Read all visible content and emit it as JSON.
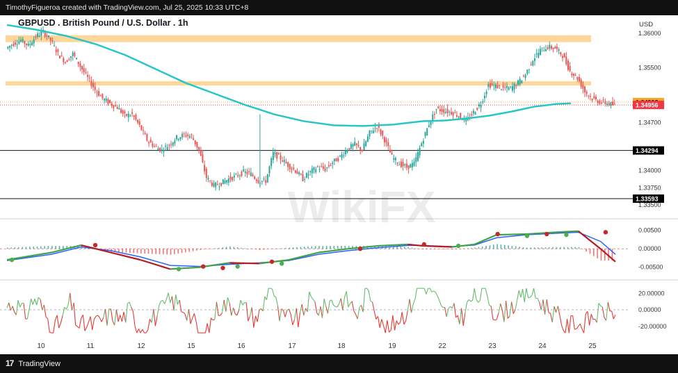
{
  "header": {
    "credit": "TimothyFigueroa created with TradingView.com, Jul 25, 2025 10:33 UTC+8"
  },
  "footer": {
    "brand": "TradingView",
    "logo_text": "17"
  },
  "watermark": {
    "text": "WikiFX"
  },
  "chart_data": {
    "type": "candlestick",
    "title": "GBPUSD . British Pound / U.S. Dollar . 1h",
    "currency": "USD",
    "price_axis": {
      "range": [
        1.3335,
        1.3618
      ],
      "ticks": [
        {
          "label": "1.36000",
          "value": 1.36
        },
        {
          "label": "1.35500",
          "value": 1.355
        },
        {
          "label": "1.34700",
          "value": 1.347
        },
        {
          "label": "1.34000",
          "value": 1.34
        },
        {
          "label": "1.33750",
          "value": 1.3375
        },
        {
          "label": "1.33500",
          "value": 1.335
        }
      ]
    },
    "price_tags": [
      {
        "label": "1.34998",
        "value": 1.34998,
        "color": "#f5a623",
        "text_color": "#000000"
      },
      {
        "label": "1.34956",
        "value": 1.34956,
        "color": "#f23645",
        "text_color": "#ffffff"
      },
      {
        "label": "1.34294",
        "value": 1.34294,
        "color": "#000000",
        "text_color": "#ffffff"
      },
      {
        "label": "1.33593",
        "value": 1.33593,
        "color": "#000000",
        "text_color": "#ffffff"
      }
    ],
    "horizontal_lines": [
      1.34294,
      1.33593
    ],
    "zones": [
      {
        "low": 1.3587,
        "high": 1.3597,
        "color": "#ffd699"
      },
      {
        "low": 1.3524,
        "high": 1.353,
        "color": "#ffd699"
      }
    ],
    "x_labels": [
      "10",
      "11",
      "12",
      "15",
      "16",
      "17",
      "18",
      "19",
      "22",
      "23",
      "24",
      "25"
    ],
    "moving_average": {
      "color": "#26c6c6",
      "points": [
        [
          0,
          1.3612
        ],
        [
          4,
          1.3605
        ],
        [
          8,
          1.3596
        ],
        [
          12,
          1.3584
        ],
        [
          16,
          1.3568
        ],
        [
          20,
          1.3548
        ],
        [
          24,
          1.3528
        ],
        [
          28,
          1.3512
        ],
        [
          32,
          1.3496
        ],
        [
          36,
          1.3482
        ],
        [
          40,
          1.3472
        ],
        [
          44,
          1.3466
        ],
        [
          48,
          1.3465
        ],
        [
          52,
          1.3467
        ],
        [
          56,
          1.3472
        ],
        [
          59,
          1.3473
        ],
        [
          62,
          1.3476
        ],
        [
          65,
          1.348
        ],
        [
          68,
          1.3486
        ],
        [
          71,
          1.3493
        ],
        [
          74,
          1.3497
        ],
        [
          76,
          1.3498
        ]
      ]
    },
    "price_path": [
      [
        0,
        1.3578
      ],
      [
        1,
        1.3585
      ],
      [
        2,
        1.359
      ],
      [
        3,
        1.3582
      ],
      [
        4,
        1.3595
      ],
      [
        5,
        1.3602
      ],
      [
        6,
        1.359
      ],
      [
        7,
        1.357
      ],
      [
        8,
        1.3558
      ],
      [
        9,
        1.357
      ],
      [
        10,
        1.3552
      ],
      [
        11,
        1.3535
      ],
      [
        12,
        1.3518
      ],
      [
        13,
        1.3505
      ],
      [
        14,
        1.3498
      ],
      [
        15,
        1.3492
      ],
      [
        16,
        1.348
      ],
      [
        17,
        1.3482
      ],
      [
        18,
        1.3465
      ],
      [
        19,
        1.3445
      ],
      [
        20,
        1.3435
      ],
      [
        21,
        1.343
      ],
      [
        22,
        1.3438
      ],
      [
        23,
        1.3448
      ],
      [
        24,
        1.3452
      ],
      [
        25,
        1.345
      ],
      [
        26,
        1.343
      ],
      [
        27,
        1.339
      ],
      [
        28,
        1.3378
      ],
      [
        29,
        1.3382
      ],
      [
        30,
        1.3388
      ],
      [
        31,
        1.3392
      ],
      [
        32,
        1.3398
      ],
      [
        33,
        1.3395
      ],
      [
        34,
        1.3385
      ],
      [
        35,
        1.3385
      ],
      [
        36,
        1.3425
      ],
      [
        37,
        1.3418
      ],
      [
        38,
        1.3408
      ],
      [
        39,
        1.34
      ],
      [
        40,
        1.3388
      ],
      [
        41,
        1.3398
      ],
      [
        42,
        1.3405
      ],
      [
        43,
        1.3402
      ],
      [
        44,
        1.3412
      ],
      [
        45,
        1.342
      ],
      [
        46,
        1.3432
      ],
      [
        47,
        1.3438
      ],
      [
        48,
        1.343
      ],
      [
        49,
        1.3455
      ],
      [
        50,
        1.3465
      ],
      [
        51,
        1.3445
      ],
      [
        52,
        1.342
      ],
      [
        53,
        1.341
      ],
      [
        54,
        1.3405
      ],
      [
        55,
        1.341
      ],
      [
        56,
        1.344
      ],
      [
        57,
        1.3468
      ],
      [
        58,
        1.349
      ],
      [
        59,
        1.3487
      ],
      [
        60,
        1.3485
      ],
      [
        61,
        1.348
      ],
      [
        62,
        1.3472
      ],
      [
        63,
        1.3485
      ],
      [
        64,
        1.3498
      ],
      [
        65,
        1.3525
      ],
      [
        66,
        1.3523
      ],
      [
        67,
        1.352
      ],
      [
        68,
        1.352
      ],
      [
        69,
        1.3528
      ],
      [
        70,
        1.354
      ],
      [
        71,
        1.3562
      ],
      [
        72,
        1.3575
      ],
      [
        73,
        1.358
      ],
      [
        74,
        1.3578
      ],
      [
        75,
        1.3568
      ],
      [
        76,
        1.3545
      ],
      [
        77,
        1.3535
      ],
      [
        78,
        1.3515
      ],
      [
        79,
        1.3505
      ],
      [
        80,
        1.35
      ],
      [
        81,
        1.3498
      ],
      [
        82,
        1.3495
      ]
    ],
    "macd": {
      "ticks": [
        {
          "label": "0.00500",
          "value": 0.005
        },
        {
          "label": "0.00000",
          "value": 0
        },
        {
          "label": "-0.00500",
          "value": -0.005
        }
      ],
      "range": [
        -0.0075,
        0.0072
      ],
      "macd_line": [
        [
          0,
          -0.003
        ],
        [
          6,
          -0.001
        ],
        [
          10,
          0.001
        ],
        [
          14,
          -0.001
        ],
        [
          18,
          -0.003
        ],
        [
          22,
          -0.0055
        ],
        [
          26,
          -0.005
        ],
        [
          30,
          -0.0038
        ],
        [
          34,
          -0.004
        ],
        [
          38,
          -0.003
        ],
        [
          42,
          -0.001
        ],
        [
          46,
          0.0
        ],
        [
          50,
          0.0008
        ],
        [
          54,
          0.0012
        ],
        [
          56,
          0.0008
        ],
        [
          60,
          0.0005
        ],
        [
          63,
          0.0012
        ],
        [
          66,
          0.0038
        ],
        [
          70,
          0.004
        ],
        [
          74,
          0.0045
        ],
        [
          77,
          0.0048
        ],
        [
          80,
          0.0
        ],
        [
          82,
          -0.0035
        ]
      ],
      "signal_line": [
        [
          0,
          -0.0032
        ],
        [
          6,
          -0.0015
        ],
        [
          10,
          0.0005
        ],
        [
          14,
          -0.0005
        ],
        [
          18,
          -0.0022
        ],
        [
          22,
          -0.0045
        ],
        [
          26,
          -0.0048
        ],
        [
          30,
          -0.0042
        ],
        [
          34,
          -0.0038
        ],
        [
          38,
          -0.0032
        ],
        [
          42,
          -0.0015
        ],
        [
          46,
          -0.0005
        ],
        [
          50,
          0.0003
        ],
        [
          54,
          0.0009
        ],
        [
          56,
          0.0009
        ],
        [
          60,
          0.0006
        ],
        [
          63,
          0.001
        ],
        [
          66,
          0.003
        ],
        [
          70,
          0.0038
        ],
        [
          74,
          0.0042
        ],
        [
          77,
          0.0045
        ],
        [
          80,
          0.002
        ],
        [
          82,
          -0.0015
        ]
      ],
      "cross_markers": [
        {
          "x": 0.5,
          "value": -0.003,
          "color": "#4caf50"
        },
        {
          "x": 9,
          "value": 0.001,
          "color": "#c62828"
        },
        {
          "x": 17.5,
          "value": -0.0055,
          "color": "#4caf50"
        },
        {
          "x": 20,
          "value": -0.0048,
          "color": "#c62828"
        },
        {
          "x": 22,
          "value": -0.0052,
          "color": "#c62828"
        },
        {
          "x": 23.5,
          "value": -0.0048,
          "color": "#4caf50"
        },
        {
          "x": 27,
          "value": -0.0035,
          "color": "#c62828"
        },
        {
          "x": 28,
          "value": -0.004,
          "color": "#4caf50"
        },
        {
          "x": 36,
          "value": 0.0,
          "color": "#c62828"
        },
        {
          "x": 42.5,
          "value": 0.0012,
          "color": "#c62828"
        },
        {
          "x": 46,
          "value": 0.0008,
          "color": "#4caf50"
        },
        {
          "x": 50,
          "value": 0.004,
          "color": "#c62828"
        },
        {
          "x": 53,
          "value": 0.0035,
          "color": "#4caf50"
        },
        {
          "x": 55,
          "value": 0.004,
          "color": "#c62828"
        },
        {
          "x": 57,
          "value": 0.0038,
          "color": "#4caf50"
        },
        {
          "x": 61,
          "value": 0.0045,
          "color": "#c62828"
        }
      ]
    },
    "oscillator": {
      "ticks": [
        {
          "label": "20.00000",
          "value": 20
        },
        {
          "label": "0.00000",
          "value": 0
        },
        {
          "label": "-20.00000",
          "value": -20
        }
      ],
      "range": [
        -32,
        32
      ]
    }
  }
}
